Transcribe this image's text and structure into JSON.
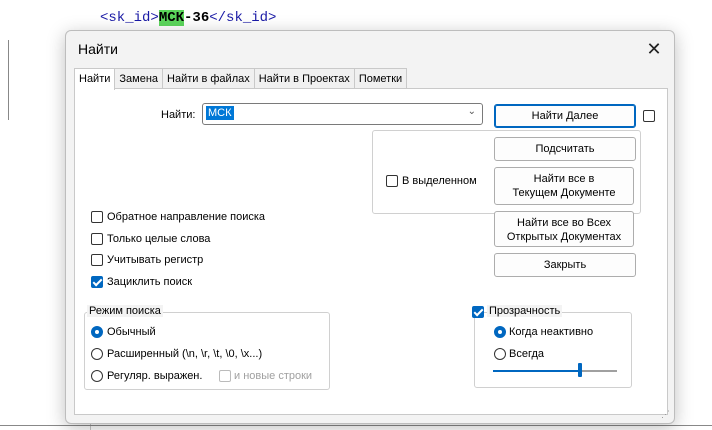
{
  "editor": {
    "line_prefix": "<sk_id>",
    "line_match": "МСК",
    "line_rest": "-36",
    "line_suffix": "</sk_id>"
  },
  "dialog": {
    "title": "Найти",
    "close_symbol": "✕",
    "tabs": [
      "Найти",
      "Замена",
      "Найти в файлах",
      "Найти в Проектах",
      "Пометки"
    ],
    "find_label": "Найти:",
    "find_value": "МСК",
    "buttons": {
      "find_next": "Найти Далее",
      "count": "Подсчитать",
      "find_all_current_l1": "Найти все в",
      "find_all_current_l2": "Текущем Документе",
      "find_all_open_l1": "Найти все во Всех",
      "find_all_open_l2": "Открытых Документах",
      "close": "Закрыть"
    },
    "in_selection_label": "В выделенном",
    "options": [
      {
        "label": "Обратное направление поиска",
        "checked": false
      },
      {
        "label": "Только целые слова",
        "checked": false
      },
      {
        "label": "Учитывать регистр",
        "checked": false
      },
      {
        "label": "Зациклить поиск",
        "checked": true
      }
    ],
    "search_mode": {
      "title": "Режим поиска",
      "normal": "Обычный",
      "extended": "Расширенный (\\n, \\r, \\t, \\0, \\x...)",
      "regex": "Регуляр. выражен.",
      "newlines": "и новые строки",
      "selected": "normal"
    },
    "transparency": {
      "label": "Прозрачность",
      "checked": true,
      "on_lose_focus": "Когда неактивно",
      "always": "Всегда",
      "selected": "on_lose_focus",
      "level": 0.7
    },
    "colors": {
      "accent": "#0067c0"
    }
  }
}
